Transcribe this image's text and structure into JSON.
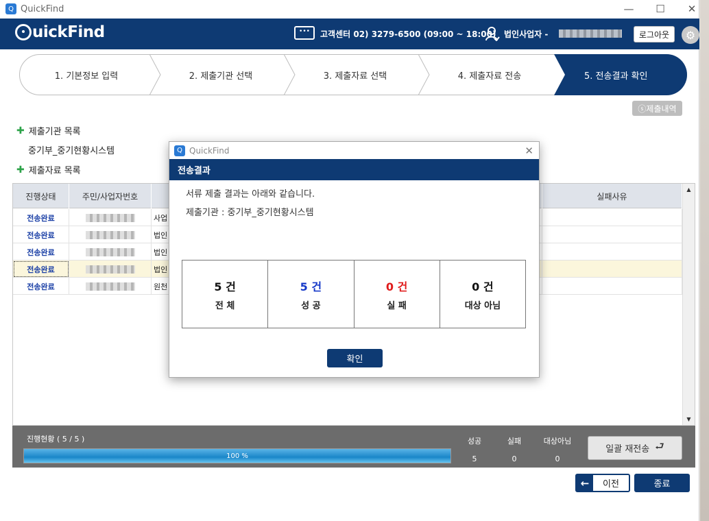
{
  "window": {
    "title": "QuickFind",
    "minimize": "—",
    "maximize": "☐",
    "close": "✕"
  },
  "header": {
    "logo": "uickFind",
    "support": "고객센터 02) 3279-6500 (09:00 ~ 18:00)",
    "user_label": "법인사업자 -",
    "logout": "로그아웃"
  },
  "steps": [
    {
      "label": "1. 기본정보 입력"
    },
    {
      "label": "2. 제출기관 선택"
    },
    {
      "label": "3. 제출자료 선택"
    },
    {
      "label": "4. 제출자료 전송"
    },
    {
      "label": "5. 전송결과 확인",
      "active": true
    }
  ],
  "history_button": "ⓢ제출내역",
  "sections": {
    "agency_list": "제출기관 목록",
    "agency_name": "중기부_중기현황시스템",
    "data_list": "제출자료 목록"
  },
  "grid": {
    "columns": [
      "진행상태",
      "주민/사업자번호",
      "실패사유"
    ],
    "rows": [
      {
        "status": "전송완료",
        "name": "사업"
      },
      {
        "status": "전송완료",
        "name": "법인"
      },
      {
        "status": "전송완료",
        "name": "법인"
      },
      {
        "status": "전송완료",
        "name": "법인",
        "selected": true
      },
      {
        "status": "전송완료",
        "name": "원천"
      }
    ]
  },
  "progress": {
    "label": "진행현황 (   5   /  5    )",
    "percent": 100,
    "percent_text": "100 %",
    "stats": [
      {
        "label": "성공",
        "value": "5"
      },
      {
        "label": "실패",
        "value": "0"
      },
      {
        "label": "대상아님",
        "value": "0"
      }
    ],
    "resend": "일괄 재전송"
  },
  "footer": {
    "prev": "이전",
    "close": "종료"
  },
  "dialog": {
    "window_title": "QuickFind",
    "header": "전송결과",
    "message": "서류 제출 결과는 아래와 같습니다.",
    "agency": "제출기관 : 중기부_중기현황시스템",
    "results": [
      {
        "count": "5 건",
        "label": "전 체",
        "color": "#111111"
      },
      {
        "count": "5 건",
        "label": "성 공",
        "color": "#1538c8"
      },
      {
        "count": "0 건",
        "label": "실 패",
        "color": "#e01b1b"
      },
      {
        "count": "0 건",
        "label": "대상 아님",
        "color": "#111111"
      }
    ],
    "ok": "확인"
  }
}
